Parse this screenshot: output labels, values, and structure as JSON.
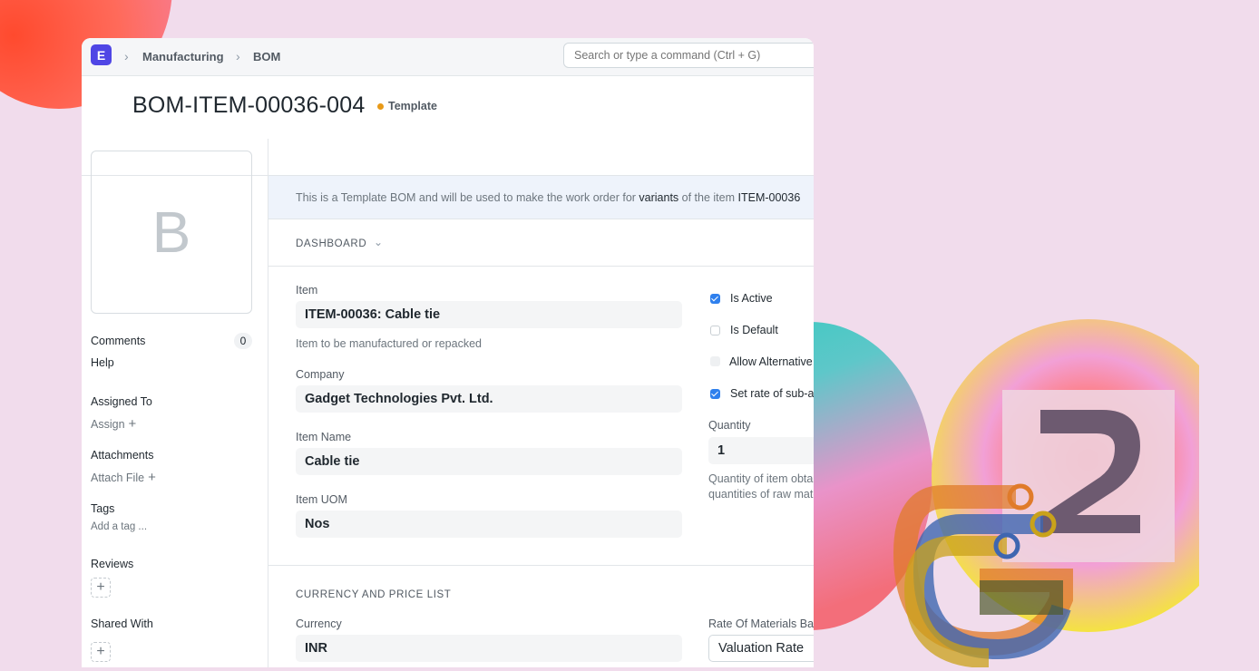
{
  "navbar": {
    "logo_letter": "E",
    "breadcrumbs": [
      "Manufacturing",
      "BOM"
    ],
    "search_placeholder": "Search or type a command (Ctrl + G)"
  },
  "page": {
    "title": "BOM-ITEM-00036-004",
    "status": "Template",
    "status_color": "#e89a18"
  },
  "sidebar": {
    "avatar_letter": "B",
    "comments_label": "Comments",
    "comments_count": "0",
    "help_label": "Help",
    "assigned_to_label": "Assigned To",
    "assign_label": "Assign",
    "attachments_label": "Attachments",
    "attach_file_label": "Attach File",
    "tags_label": "Tags",
    "add_tag_label": "Add a tag ...",
    "reviews_label": "Reviews",
    "shared_with_label": "Shared With",
    "plus_glyph": "+"
  },
  "banner": {
    "text_prefix": "This is a Template BOM and will be used to make the work order for ",
    "highlight_1": "variants",
    "text_middle": " of the item ",
    "highlight_2": "ITEM-00036"
  },
  "dashboard": {
    "label": "DASHBOARD"
  },
  "form": {
    "item_label": "Item",
    "item_value": "ITEM-00036: Cable tie",
    "item_help": "Item to be manufactured or repacked",
    "company_label": "Company",
    "company_value": "Gadget Technologies Pvt. Ltd.",
    "item_name_label": "Item Name",
    "item_name_value": "Cable tie",
    "item_uom_label": "Item UOM",
    "item_uom_value": "Nos",
    "checkboxes": [
      {
        "label": "Is Active",
        "checked": true
      },
      {
        "label": "Is Default",
        "checked": false
      },
      {
        "label": "Allow Alternative Item",
        "checked": false,
        "disabled": true
      },
      {
        "label": "Set rate of sub-assembly item based on BOM",
        "checked": true
      }
    ],
    "quantity_label": "Quantity",
    "quantity_value": "1",
    "quantity_help_1": "Quantity of item obtained after manufacturing / repacking from given",
    "quantity_help_2": "quantities of raw materials",
    "currency_section": "CURRENCY AND PRICE LIST",
    "currency_label": "Currency",
    "currency_value": "INR",
    "rate_label": "Rate Of Materials Based On",
    "rate_value": "Valuation Rate"
  }
}
